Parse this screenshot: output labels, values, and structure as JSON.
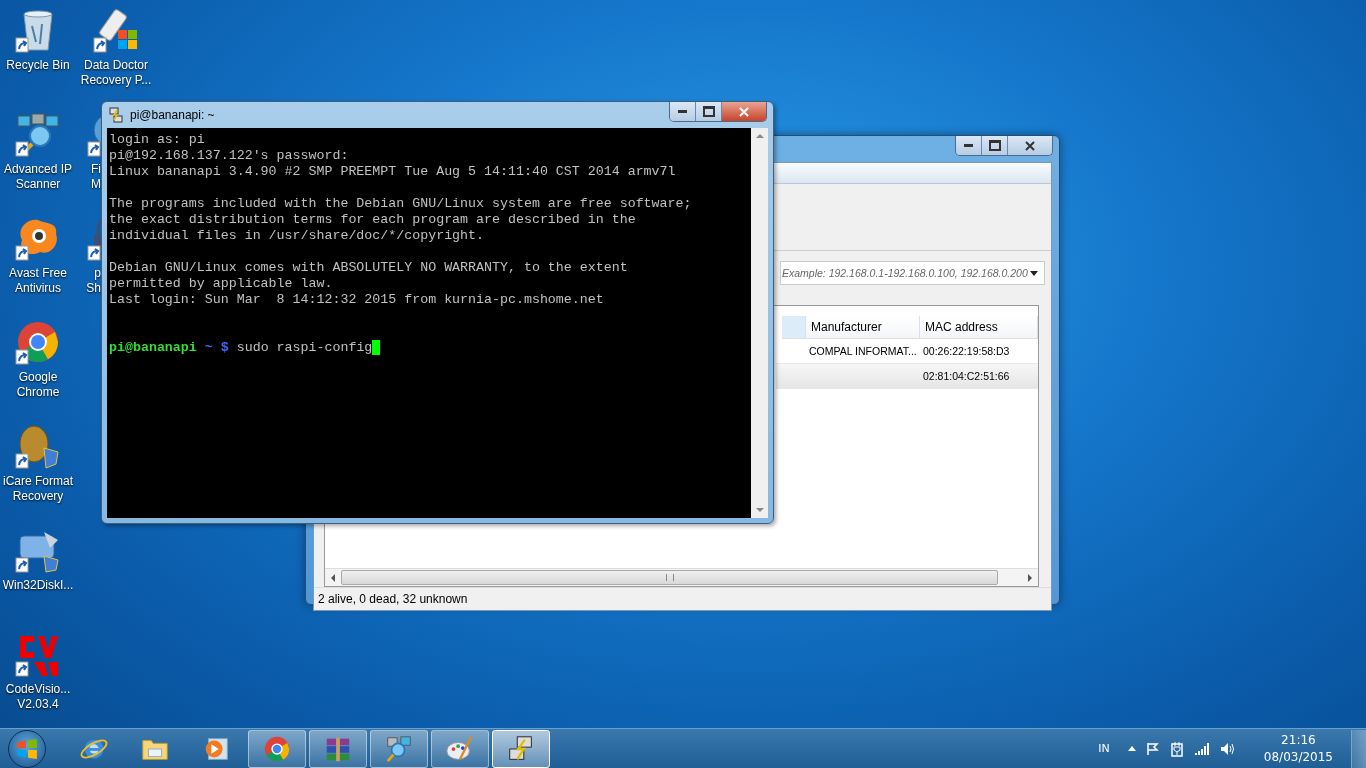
{
  "desktop_icons": [
    {
      "kind": "recycle",
      "lines": [
        "Recycle Bin"
      ]
    },
    {
      "kind": "scanner",
      "lines": [
        "Advanced IP",
        "Scanner"
      ]
    },
    {
      "kind": "avast",
      "lines": [
        "Avast Free",
        "Antivirus"
      ]
    },
    {
      "kind": "chrome",
      "lines": [
        "Google",
        "Chrome"
      ]
    },
    {
      "kind": "icare",
      "lines": [
        "iCare Format",
        "Recovery"
      ]
    },
    {
      "kind": "disk",
      "lines": [
        "Win32DiskI..."
      ]
    },
    {
      "kind": "cv",
      "lines": [
        "CodeVisio...",
        "V2.03.4"
      ]
    },
    {
      "kind": "usb",
      "lines": [
        "Data Doctor",
        "Recovery P..."
      ]
    },
    {
      "kind": "round",
      "lines": [
        "Fi",
        "M"
      ]
    },
    {
      "kind": "lock",
      "lines": [
        "p",
        "Sh"
      ]
    }
  ],
  "scanner_window": {
    "range_placeholder": "Example: 192.168.0.1-192.168.0.100, 192.168.0.200",
    "columns": [
      "Manufacturer",
      "MAC address"
    ],
    "rows": [
      {
        "manufacturer": "COMPAL INFORMAT...",
        "mac": "00:26:22:19:58:D3"
      },
      {
        "mac": "02:81:04:C2:51:66"
      }
    ],
    "status": "2 alive, 0 dead, 32 unknown"
  },
  "terminal": {
    "title": "pi@bananapi: ~",
    "blocks": [
      [
        "login as: pi",
        "pi@192.168.137.122's password:",
        "Linux bananapi 3.4.90 #2 SMP PREEMPT Tue Aug 5 14:11:40 CST 2014 armv7l"
      ],
      [
        "The programs included with the Debian GNU/Linux system are free software;",
        "the exact distribution terms for each program are described in the",
        "individual files in /usr/share/doc/*/copyright."
      ],
      [
        "Debian GNU/Linux comes with ABSOLUTELY NO WARRANTY, to the extent",
        "permitted by applicable law.",
        "Last login: Sun Mar  8 14:12:32 2015 from kurnia-pc.mshome.net"
      ]
    ],
    "prompt": {
      "user": "pi@bananapi",
      "path": "~ $",
      "command": "sudo raspi-config"
    }
  },
  "taskbar": {
    "items": [
      {
        "kind": "ie",
        "running": false,
        "selected": false
      },
      {
        "kind": "explorer",
        "running": false,
        "selected": false
      },
      {
        "kind": "media",
        "running": false,
        "selected": false
      },
      {
        "kind": "chrome",
        "running": true,
        "selected": false
      },
      {
        "kind": "winrar",
        "running": true,
        "selected": false
      },
      {
        "kind": "scanner",
        "running": true,
        "selected": false
      },
      {
        "kind": "paint",
        "running": true,
        "selected": false
      },
      {
        "kind": "putty",
        "running": true,
        "selected": true
      }
    ],
    "language": "IN",
    "time": "21:16",
    "date": "08/03/2015"
  }
}
